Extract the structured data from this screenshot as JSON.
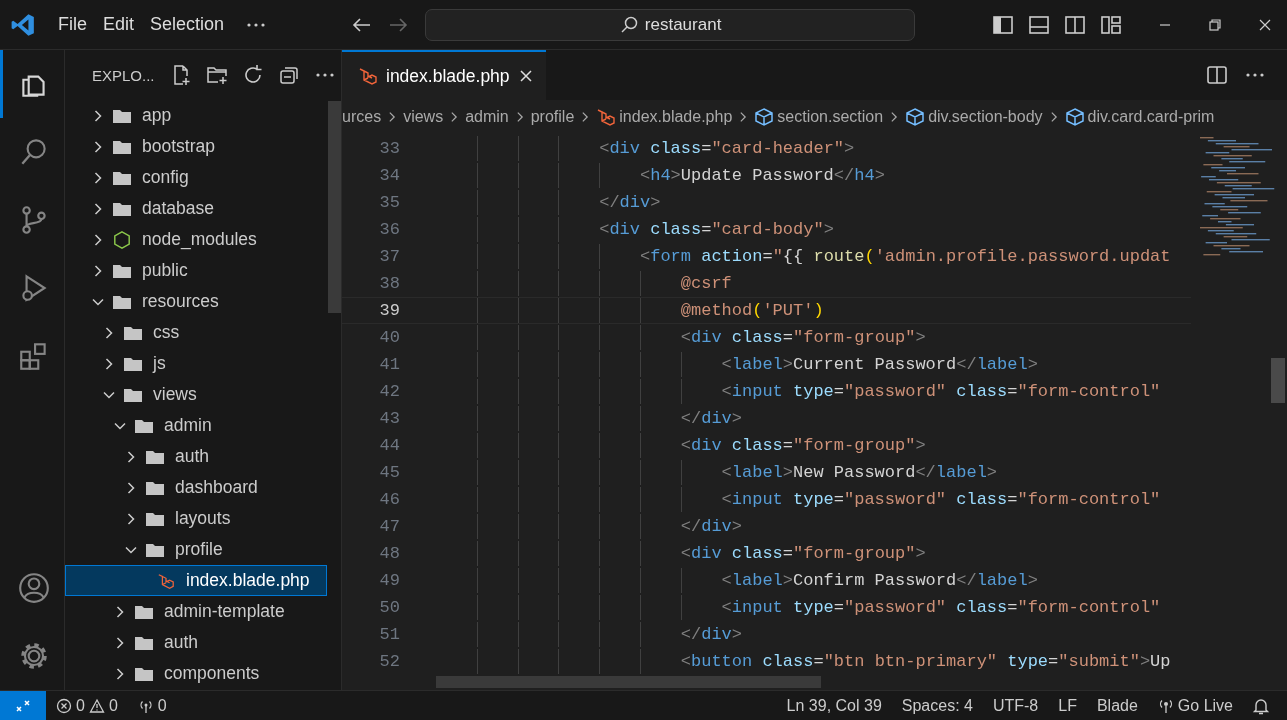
{
  "window": {
    "menu": [
      "File",
      "Edit",
      "Selection"
    ],
    "search": {
      "value": "restaurant"
    }
  },
  "activity_bar": [
    {
      "kind": "explorer",
      "selected": true
    },
    {
      "kind": "search",
      "selected": false
    },
    {
      "kind": "source-control",
      "selected": false
    },
    {
      "kind": "run",
      "selected": false
    },
    {
      "kind": "extensions",
      "selected": false
    }
  ],
  "activity_bar_bottom": [
    {
      "kind": "account"
    },
    {
      "kind": "settings"
    }
  ],
  "sidebar": {
    "title": "EXPLO...",
    "tree": [
      {
        "label": "app",
        "kind": "folder",
        "expanded": false,
        "selected": false
      },
      {
        "label": "bootstrap",
        "kind": "folder",
        "expanded": false,
        "selected": false
      },
      {
        "label": "config",
        "kind": "folder",
        "expanded": false,
        "selected": false
      },
      {
        "label": "database",
        "kind": "folder",
        "expanded": false,
        "selected": false
      },
      {
        "label": "node_modules",
        "kind": "node",
        "expanded": false,
        "selected": false
      },
      {
        "label": "public",
        "kind": "folder",
        "expanded": false,
        "selected": false
      },
      {
        "label": "resources",
        "kind": "folder",
        "expanded": true,
        "selected": false,
        "children": [
          {
            "label": "css",
            "kind": "folder",
            "expanded": false,
            "selected": false
          },
          {
            "label": "js",
            "kind": "folder",
            "expanded": false,
            "selected": false
          },
          {
            "label": "views",
            "kind": "folder",
            "expanded": true,
            "selected": false,
            "children": [
              {
                "label": "admin",
                "kind": "folder",
                "expanded": true,
                "selected": false,
                "children": [
                  {
                    "label": "auth",
                    "kind": "folder",
                    "expanded": false,
                    "selected": false
                  },
                  {
                    "label": "dashboard",
                    "kind": "folder",
                    "expanded": false,
                    "selected": false
                  },
                  {
                    "label": "layouts",
                    "kind": "folder",
                    "expanded": false,
                    "selected": false
                  },
                  {
                    "label": "profile",
                    "kind": "folder",
                    "expanded": true,
                    "selected": false,
                    "children": [
                      {
                        "label": "index.blade.php",
                        "kind": "blade",
                        "selected": true
                      }
                    ]
                  }
                ]
              },
              {
                "label": "admin-template",
                "kind": "folder",
                "expanded": false,
                "selected": false
              },
              {
                "label": "auth",
                "kind": "folder",
                "expanded": false,
                "selected": false
              },
              {
                "label": "components",
                "kind": "folder",
                "expanded": false,
                "selected": false
              }
            ]
          }
        ]
      }
    ]
  },
  "tabs": [
    {
      "label": "index.blade.php",
      "selected": true
    }
  ],
  "breadcrumbs": [
    {
      "label": "urces",
      "kind": "folder"
    },
    {
      "label": "views",
      "kind": "folder"
    },
    {
      "label": "admin",
      "kind": "folder"
    },
    {
      "label": "profile",
      "kind": "folder"
    },
    {
      "label": "index.blade.php",
      "kind": "blade"
    },
    {
      "label": "section.section",
      "kind": "symbol"
    },
    {
      "label": "div.section-body",
      "kind": "symbol"
    },
    {
      "label": "div.card.card-prim",
      "kind": "symbol"
    }
  ],
  "editor": {
    "lines": [
      {
        "number": "33",
        "current": false,
        "tokens": [
          {
            "kind": "p",
            "text": "<"
          },
          {
            "kind": "tag",
            "text": "div"
          },
          {
            "kind": "attr",
            "text": " class"
          },
          {
            "kind": "txt",
            "text": "="
          },
          {
            "kind": "str",
            "text": "\"card-header\""
          },
          {
            "kind": "p",
            "text": ">"
          }
        ],
        "children": [
          {
            "number": "34",
            "current": false,
            "tokens": [
              {
                "kind": "p",
                "text": "<"
              },
              {
                "kind": "tag",
                "text": "h4"
              },
              {
                "kind": "p",
                "text": ">"
              },
              {
                "kind": "txt",
                "text": "Update Password"
              },
              {
                "kind": "p",
                "text": "</"
              },
              {
                "kind": "tag",
                "text": "h4"
              },
              {
                "kind": "p",
                "text": ">"
              }
            ]
          }
        ]
      },
      {
        "number": "35",
        "current": false,
        "tokens": [
          {
            "kind": "p",
            "text": "</"
          },
          {
            "kind": "tag",
            "text": "div"
          },
          {
            "kind": "p",
            "text": ">"
          }
        ]
      },
      {
        "number": "36",
        "current": false,
        "tokens": [
          {
            "kind": "p",
            "text": "<"
          },
          {
            "kind": "tag",
            "text": "div"
          },
          {
            "kind": "attr",
            "text": " class"
          },
          {
            "kind": "txt",
            "text": "="
          },
          {
            "kind": "str",
            "text": "\"card-body\""
          },
          {
            "kind": "p",
            "text": ">"
          }
        ],
        "children": [
          {
            "number": "37",
            "current": false,
            "tokens": [
              {
                "kind": "p",
                "text": "<"
              },
              {
                "kind": "tag",
                "text": "form"
              },
              {
                "kind": "attr",
                "text": " action"
              },
              {
                "kind": "txt",
                "text": "="
              },
              {
                "kind": "str",
                "text": "\""
              },
              {
                "kind": "txt",
                "text": "{{ "
              },
              {
                "kind": "fn",
                "text": "route"
              },
              {
                "kind": "brace",
                "text": "("
              },
              {
                "kind": "str",
                "text": "'admin.profile.password.updat"
              }
            ],
            "children": [
              {
                "number": "38",
                "current": false,
                "tokens": [
                  {
                    "kind": "dir",
                    "text": "@csrf"
                  }
                ]
              },
              {
                "number": "39",
                "current": true,
                "tokens": [
                  {
                    "kind": "dir",
                    "text": "@method"
                  },
                  {
                    "kind": "brace",
                    "text": "("
                  },
                  {
                    "kind": "str",
                    "text": "'PUT'"
                  },
                  {
                    "kind": "brace",
                    "text": ")"
                  }
                ]
              },
              {
                "number": "40",
                "current": false,
                "tokens": [
                  {
                    "kind": "p",
                    "text": "<"
                  },
                  {
                    "kind": "tag",
                    "text": "div"
                  },
                  {
                    "kind": "attr",
                    "text": " class"
                  },
                  {
                    "kind": "txt",
                    "text": "="
                  },
                  {
                    "kind": "str",
                    "text": "\"form-group\""
                  },
                  {
                    "kind": "p",
                    "text": ">"
                  }
                ],
                "children": [
                  {
                    "number": "41",
                    "current": false,
                    "tokens": [
                      {
                        "kind": "p",
                        "text": "<"
                      },
                      {
                        "kind": "tag",
                        "text": "label"
                      },
                      {
                        "kind": "p",
                        "text": ">"
                      },
                      {
                        "kind": "txt",
                        "text": "Current Password"
                      },
                      {
                        "kind": "p",
                        "text": "</"
                      },
                      {
                        "kind": "tag",
                        "text": "label"
                      },
                      {
                        "kind": "p",
                        "text": ">"
                      }
                    ]
                  },
                  {
                    "number": "42",
                    "current": false,
                    "tokens": [
                      {
                        "kind": "p",
                        "text": "<"
                      },
                      {
                        "kind": "tag",
                        "text": "input"
                      },
                      {
                        "kind": "attr",
                        "text": " type"
                      },
                      {
                        "kind": "txt",
                        "text": "="
                      },
                      {
                        "kind": "str",
                        "text": "\"password\""
                      },
                      {
                        "kind": "attr",
                        "text": " class"
                      },
                      {
                        "kind": "txt",
                        "text": "="
                      },
                      {
                        "kind": "str",
                        "text": "\"form-control\""
                      }
                    ]
                  }
                ]
              },
              {
                "number": "43",
                "current": false,
                "tokens": [
                  {
                    "kind": "p",
                    "text": "</"
                  },
                  {
                    "kind": "tag",
                    "text": "div"
                  },
                  {
                    "kind": "p",
                    "text": ">"
                  }
                ]
              },
              {
                "number": "44",
                "current": false,
                "tokens": [
                  {
                    "kind": "p",
                    "text": "<"
                  },
                  {
                    "kind": "tag",
                    "text": "div"
                  },
                  {
                    "kind": "attr",
                    "text": " class"
                  },
                  {
                    "kind": "txt",
                    "text": "="
                  },
                  {
                    "kind": "str",
                    "text": "\"form-group\""
                  },
                  {
                    "kind": "p",
                    "text": ">"
                  }
                ],
                "children": [
                  {
                    "number": "45",
                    "current": false,
                    "tokens": [
                      {
                        "kind": "p",
                        "text": "<"
                      },
                      {
                        "kind": "tag",
                        "text": "label"
                      },
                      {
                        "kind": "p",
                        "text": ">"
                      },
                      {
                        "kind": "txt",
                        "text": "New Password"
                      },
                      {
                        "kind": "p",
                        "text": "</"
                      },
                      {
                        "kind": "tag",
                        "text": "label"
                      },
                      {
                        "kind": "p",
                        "text": ">"
                      }
                    ]
                  },
                  {
                    "number": "46",
                    "current": false,
                    "tokens": [
                      {
                        "kind": "p",
                        "text": "<"
                      },
                      {
                        "kind": "tag",
                        "text": "input"
                      },
                      {
                        "kind": "attr",
                        "text": " type"
                      },
                      {
                        "kind": "txt",
                        "text": "="
                      },
                      {
                        "kind": "str",
                        "text": "\"password\""
                      },
                      {
                        "kind": "attr",
                        "text": " class"
                      },
                      {
                        "kind": "txt",
                        "text": "="
                      },
                      {
                        "kind": "str",
                        "text": "\"form-control\""
                      }
                    ]
                  }
                ]
              },
              {
                "number": "47",
                "current": false,
                "tokens": [
                  {
                    "kind": "p",
                    "text": "</"
                  },
                  {
                    "kind": "tag",
                    "text": "div"
                  },
                  {
                    "kind": "p",
                    "text": ">"
                  }
                ]
              },
              {
                "number": "48",
                "current": false,
                "tokens": [
                  {
                    "kind": "p",
                    "text": "<"
                  },
                  {
                    "kind": "tag",
                    "text": "div"
                  },
                  {
                    "kind": "attr",
                    "text": " class"
                  },
                  {
                    "kind": "txt",
                    "text": "="
                  },
                  {
                    "kind": "str",
                    "text": "\"form-group\""
                  },
                  {
                    "kind": "p",
                    "text": ">"
                  }
                ],
                "children": [
                  {
                    "number": "49",
                    "current": false,
                    "tokens": [
                      {
                        "kind": "p",
                        "text": "<"
                      },
                      {
                        "kind": "tag",
                        "text": "label"
                      },
                      {
                        "kind": "p",
                        "text": ">"
                      },
                      {
                        "kind": "txt",
                        "text": "Confirm Password"
                      },
                      {
                        "kind": "p",
                        "text": "</"
                      },
                      {
                        "kind": "tag",
                        "text": "label"
                      },
                      {
                        "kind": "p",
                        "text": ">"
                      }
                    ]
                  },
                  {
                    "number": "50",
                    "current": false,
                    "tokens": [
                      {
                        "kind": "p",
                        "text": "<"
                      },
                      {
                        "kind": "tag",
                        "text": "input"
                      },
                      {
                        "kind": "attr",
                        "text": " type"
                      },
                      {
                        "kind": "txt",
                        "text": "="
                      },
                      {
                        "kind": "str",
                        "text": "\"password\""
                      },
                      {
                        "kind": "attr",
                        "text": " class"
                      },
                      {
                        "kind": "txt",
                        "text": "="
                      },
                      {
                        "kind": "str",
                        "text": "\"form-control\""
                      }
                    ]
                  }
                ]
              },
              {
                "number": "51",
                "current": false,
                "tokens": [
                  {
                    "kind": "p",
                    "text": "</"
                  },
                  {
                    "kind": "tag",
                    "text": "div"
                  },
                  {
                    "kind": "p",
                    "text": ">"
                  }
                ]
              },
              {
                "number": "52",
                "current": false,
                "tokens": [
                  {
                    "kind": "p",
                    "text": "<"
                  },
                  {
                    "kind": "tag",
                    "text": "button"
                  },
                  {
                    "kind": "attr",
                    "text": " class"
                  },
                  {
                    "kind": "txt",
                    "text": "="
                  },
                  {
                    "kind": "str",
                    "text": "\"btn btn-primary\""
                  },
                  {
                    "kind": "attr",
                    "text": " type"
                  },
                  {
                    "kind": "txt",
                    "text": "="
                  },
                  {
                    "kind": "str",
                    "text": "\"submit\""
                  },
                  {
                    "kind": "p",
                    "text": ">"
                  },
                  {
                    "kind": "txt",
                    "text": "Up"
                  }
                ]
              }
            ]
          }
        ]
      }
    ]
  },
  "status_bar": {
    "errors": "0",
    "warnings": "0",
    "ports": "0",
    "items": [
      {
        "kind": "text",
        "text": "Ln 39, Col 39"
      },
      {
        "kind": "text",
        "text": "Spaces: 4"
      },
      {
        "kind": "text",
        "text": "UTF-8"
      },
      {
        "kind": "text",
        "text": "LF"
      },
      {
        "kind": "text",
        "text": "Blade"
      },
      {
        "kind": "golive",
        "text": "Go Live"
      }
    ]
  }
}
